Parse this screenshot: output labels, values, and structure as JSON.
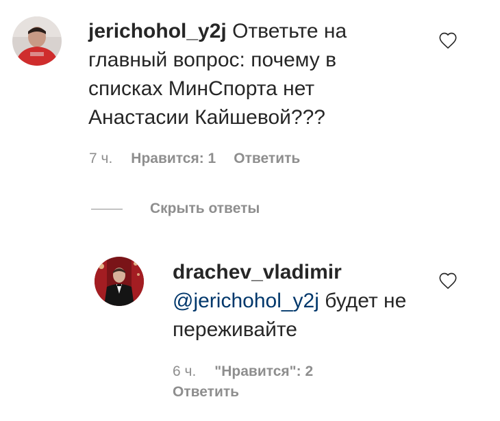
{
  "comment": {
    "username": "jerichohol_y2j",
    "text": " Ответьте на главный вопрос: почему в списках МинСпорта нет Анастасии Кайшевой???",
    "time": "7 ч.",
    "likes": "Нравится: 1",
    "reply": "Ответить",
    "like_icon": "heart-outline-icon"
  },
  "replies_toggle": {
    "label": "Скрыть ответы"
  },
  "reply": {
    "username": "drachev_vladimir",
    "mention": "@jerichohol_y2j",
    "text": " будет не переживайте",
    "time": "6 ч.",
    "likes": "\"Нравится\": 2",
    "reply": "Ответить",
    "like_icon": "heart-outline-icon"
  },
  "colors": {
    "text": "#262626",
    "secondary": "#8e8e8e",
    "mention": "#00376b"
  }
}
